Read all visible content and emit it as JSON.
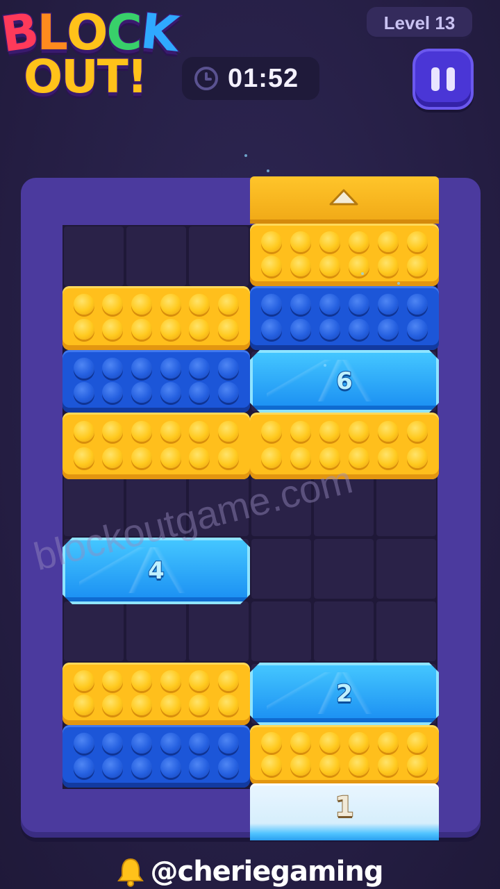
{
  "logo": {
    "line1": [
      "B",
      "L",
      "O",
      "C",
      "K"
    ],
    "line2": "OUT!"
  },
  "header": {
    "level": "Level 13",
    "timer": "01:52",
    "timer_icon": "clock-icon",
    "pause_icon": "pause-icon"
  },
  "board": {
    "exit_icon": "up-arrow-icon",
    "blocks": [
      {
        "id": "yellow-top-right",
        "color": "yellow"
      },
      {
        "id": "yellow-row2-left",
        "color": "yellow"
      },
      {
        "id": "blue-row2-right",
        "color": "blue"
      },
      {
        "id": "blue-row3-left",
        "color": "blue"
      },
      {
        "id": "ice-6",
        "color": "ice",
        "count": "6"
      },
      {
        "id": "yellow-row4-left",
        "color": "yellow"
      },
      {
        "id": "yellow-row4-right",
        "color": "yellow"
      },
      {
        "id": "ice-4",
        "color": "ice",
        "count": "4"
      },
      {
        "id": "yellow-row8-left",
        "color": "yellow"
      },
      {
        "id": "ice-2",
        "color": "ice",
        "count": "2"
      },
      {
        "id": "blue-row9-left",
        "color": "blue"
      },
      {
        "id": "yellow-row9-right",
        "color": "yellow"
      },
      {
        "id": "frost-1",
        "color": "frost",
        "count": "1"
      }
    ]
  },
  "watermark": "blockoutgame.com",
  "footer": {
    "icon": "bell-icon",
    "handle": "@cheriegaming"
  },
  "colors": {
    "background": "#272046",
    "board": "#4b3a9e",
    "yellow": "#ffbf1c",
    "blue": "#1c56d8",
    "ice": "#1a8ef2",
    "pause": "#4a36d6"
  }
}
